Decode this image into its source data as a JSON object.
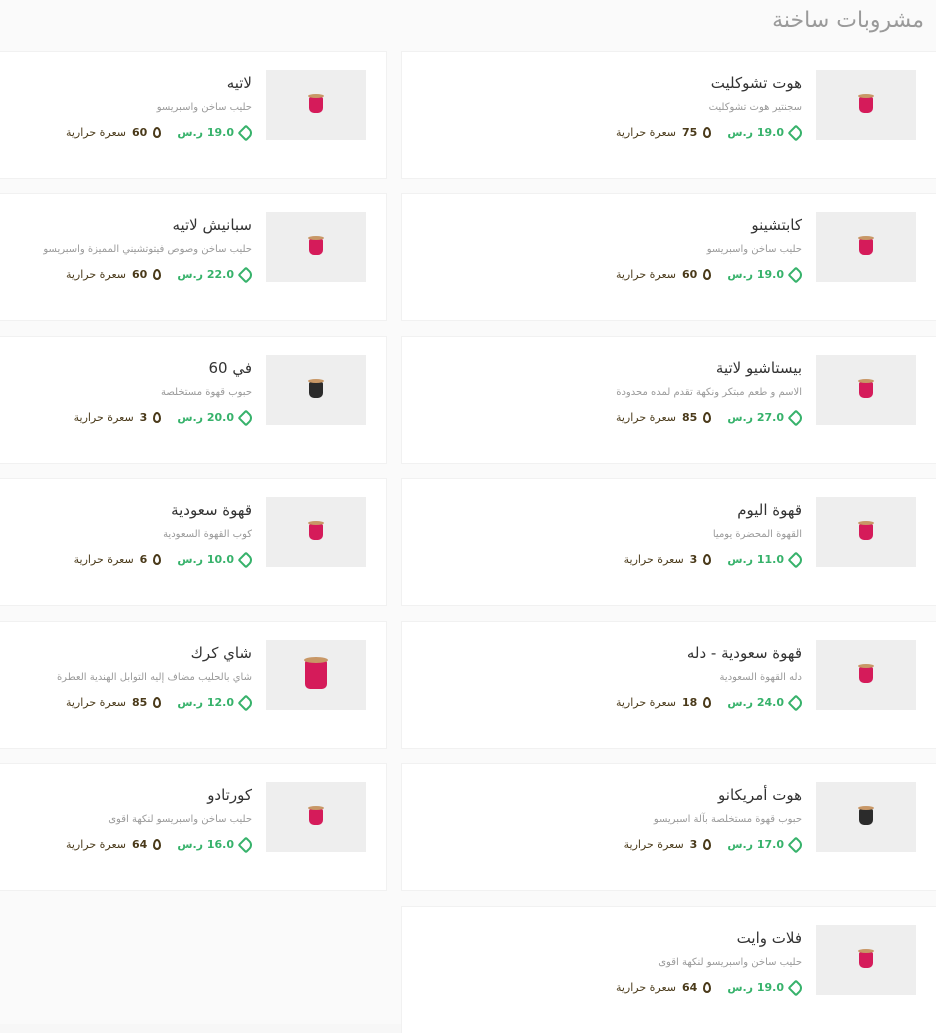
{
  "section_title": "مشروبات ساخنة",
  "currency": "ر.س",
  "calorie_label": "سعرة حرارية",
  "items_right": [
    {
      "name": "هوت تشوكليت",
      "desc": "سجنتير هوت تشوكليت",
      "price": "19.0",
      "calories": "75",
      "cup": "pink"
    },
    {
      "name": "كابتشينو",
      "desc": "حليب ساخن واسبريسو",
      "price": "19.0",
      "calories": "60",
      "cup": "pink"
    },
    {
      "name": "بيستاشيو لاتية",
      "desc": "الاسم و طعم مبتكر ونكهة تقدم لمده محدودة",
      "price": "27.0",
      "calories": "85",
      "cup": "pink"
    },
    {
      "name": "قهوة اليوم",
      "desc": "القهوة المحضرة يوميا",
      "price": "11.0",
      "calories": "3",
      "cup": "pink"
    },
    {
      "name": "قهوة سعودية - دله",
      "desc": "دله القهوة السعودية",
      "price": "24.0",
      "calories": "18",
      "cup": "pink"
    },
    {
      "name": "هوت أمريكانو",
      "desc": "حبوب قهوة مستخلصة بآلة اسبريسو",
      "price": "17.0",
      "calories": "3",
      "cup": "dark"
    },
    {
      "name": "فلات وايت",
      "desc": "حليب ساخن واسبريسو لنكهة اقوى",
      "price": "19.0",
      "calories": "64",
      "cup": "pink"
    }
  ],
  "items_left": [
    {
      "name": "لاتيه",
      "desc": "حليب ساخن واسبريسو",
      "price": "19.0",
      "calories": "60",
      "cup": "pink"
    },
    {
      "name": "سبانيش لاتيه",
      "desc": "حليب ساخن وصوص فيتوتشيني المميزة واسبريسو",
      "price": "22.0",
      "calories": "60",
      "cup": "pink"
    },
    {
      "name": "في 60",
      "desc": "حبوب قهوة مستخلصة",
      "price": "20.0",
      "calories": "3",
      "cup": "dark"
    },
    {
      "name": "قهوة سعودية",
      "desc": "كوب القهوة السعودية",
      "price": "10.0",
      "calories": "6",
      "cup": "pink"
    },
    {
      "name": "شاي كرك",
      "desc": "شاي بالحليب مضاف إليه التوابل الهندية العطرة",
      "price": "12.0",
      "calories": "85",
      "cup": "big"
    },
    {
      "name": "كورتادو",
      "desc": "حليب ساخن واسبريسو لنكهة اقوى",
      "price": "16.0",
      "calories": "64",
      "cup": "pink"
    }
  ]
}
